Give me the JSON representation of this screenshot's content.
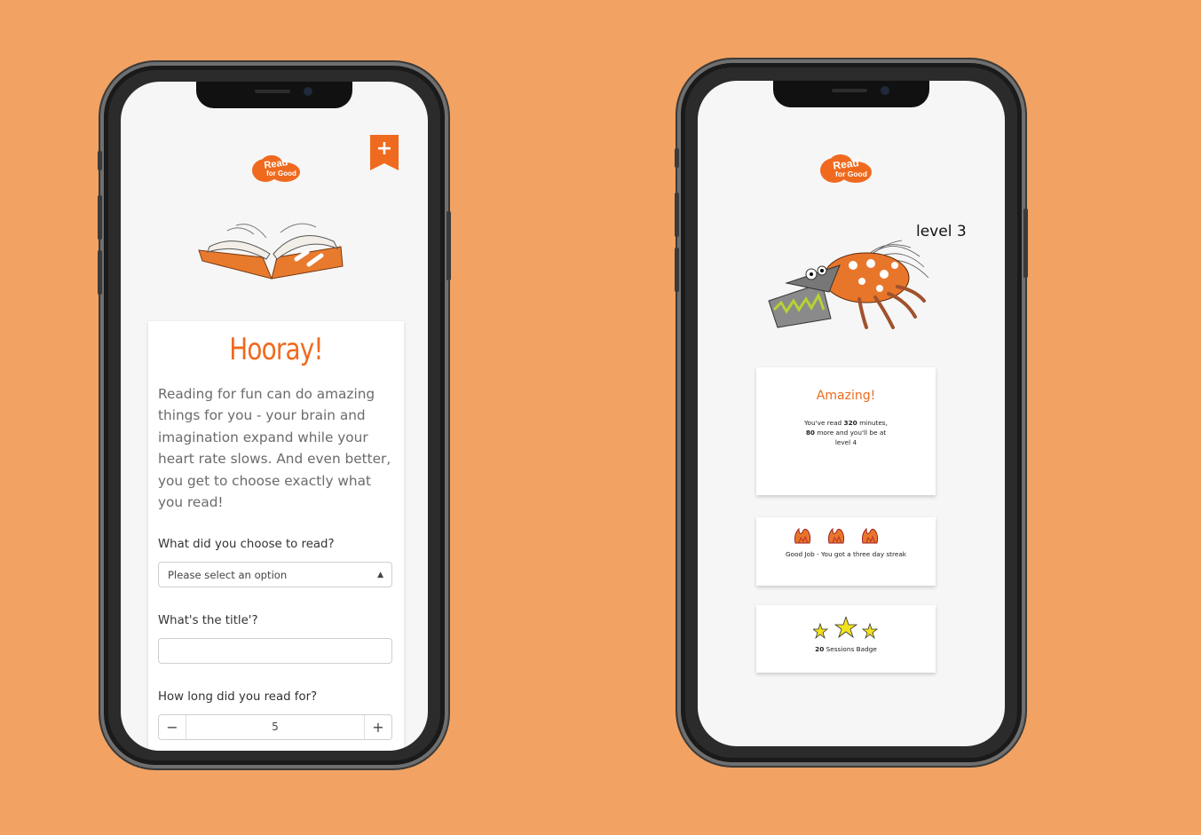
{
  "colors": {
    "background": "#F2A262",
    "brand": "#EF6A1E"
  },
  "left": {
    "logo": {
      "line1": "Read",
      "line2": "for Good"
    },
    "bookmark": {
      "icon": "plus-icon",
      "symbol": "+"
    },
    "card": {
      "title": "Hooray!",
      "intro": "Reading for fun can do amazing things for you - your brain and imagination expand while your heart rate slows. And even better, you get to choose exactly what you read!",
      "q1": "What did you choose to read?",
      "select_placeholder": "Please select an option",
      "q2": "What's the title'?",
      "title_value": "",
      "q3": "How long did you read for?",
      "stepper": {
        "minus": "−",
        "value": "5",
        "plus": "+"
      }
    }
  },
  "right": {
    "logo": {
      "line1": "Read",
      "line2": "for Good"
    },
    "level": "level 3",
    "progress_card": {
      "headline": "Amazing!",
      "line1_pre": "You've read ",
      "minutes": "320",
      "line1_post": " minutes,",
      "more": "80",
      "line2_post": " more and you'll be at",
      "line3": "level 4"
    },
    "streak_card": {
      "icon": "flame-icon",
      "text": "Good Job - You got a three day streak"
    },
    "badge_card": {
      "icon": "star-icon",
      "count": "20",
      "text": " Sessions Badge"
    }
  }
}
